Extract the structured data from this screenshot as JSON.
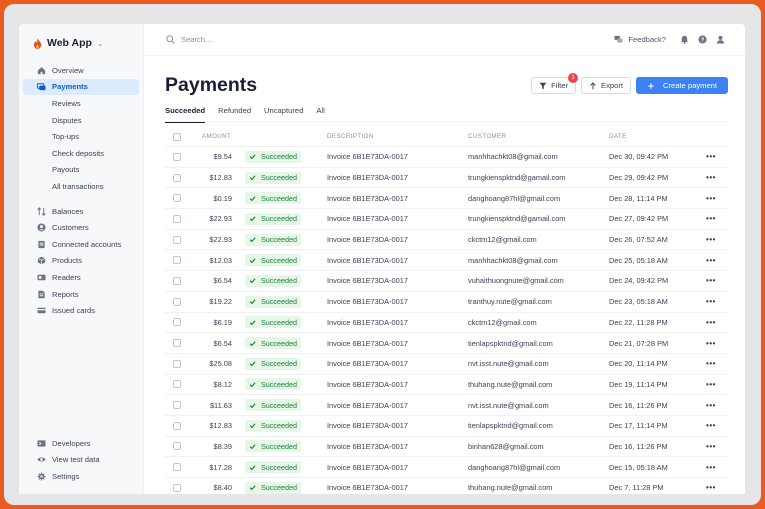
{
  "app": {
    "name": "Web App"
  },
  "sidebar": {
    "items": [
      {
        "label": "Overview",
        "icon": "home-icon",
        "active": false,
        "sub": false
      },
      {
        "label": "Payments",
        "icon": "payments-icon",
        "active": true,
        "sub": false
      },
      {
        "label": "Reviews",
        "icon": "",
        "active": false,
        "sub": true
      },
      {
        "label": "Disputes",
        "icon": "",
        "active": false,
        "sub": true
      },
      {
        "label": "Top-ups",
        "icon": "",
        "active": false,
        "sub": true
      },
      {
        "label": "Check deposits",
        "icon": "",
        "active": false,
        "sub": true
      },
      {
        "label": "Payouts",
        "icon": "",
        "active": false,
        "sub": true
      },
      {
        "label": "All transactions",
        "icon": "",
        "active": false,
        "sub": true
      }
    ],
    "items2": [
      {
        "label": "Balances",
        "icon": "balances-icon"
      },
      {
        "label": "Customers",
        "icon": "customers-icon"
      },
      {
        "label": "Connected accounts",
        "icon": "connected-accounts-icon"
      },
      {
        "label": "Products",
        "icon": "products-icon"
      },
      {
        "label": "Readers",
        "icon": "readers-icon"
      },
      {
        "label": "Reports",
        "icon": "reports-icon"
      },
      {
        "label": "Issued cards",
        "icon": "card-icon"
      }
    ],
    "bottom": [
      {
        "label": "Developers",
        "icon": "terminal-icon"
      },
      {
        "label": "View test data",
        "icon": "eye-icon"
      },
      {
        "label": "Settings",
        "icon": "gear-icon"
      }
    ]
  },
  "topbar": {
    "search_placeholder": "Search...",
    "feedback_label": "Feedback?"
  },
  "page": {
    "title": "Payments",
    "filter_label": "Filter",
    "filter_badge": "1",
    "export_label": "Export",
    "create_label": "Create payment",
    "tabs": [
      "Succeeded",
      "Refunded",
      "Uncaptured",
      "All"
    ]
  },
  "table": {
    "headers": {
      "amount": "AMOUNT",
      "description": "DESCRIPTION",
      "customer": "CUSTOMER",
      "date": "DATE"
    },
    "rows": [
      {
        "amount": "$9.54",
        "status": "Succeeded",
        "description": "Invoice 6B1E73DA-0017",
        "customer": "manhhachkt08@gmail.com",
        "date": "Dec 30, 09:42 PM"
      },
      {
        "amount": "$12.83",
        "status": "Succeeded",
        "description": "Invoice 6B1E73DA-0017",
        "customer": "trungkienspktnd@gamail.com",
        "date": "Dec 29, 09:42 PM"
      },
      {
        "amount": "$0.19",
        "status": "Succeeded",
        "description": "Invoice 6B1E73DA-0017",
        "customer": "danghoang87hl@gmail.com",
        "date": "Dec 28, 11:14 PM"
      },
      {
        "amount": "$22.93",
        "status": "Succeeded",
        "description": "Invoice 6B1E73DA-0017",
        "customer": "trungkienspktnd@gamail.com",
        "date": "Dec 27, 09:42 PM"
      },
      {
        "amount": "$22.93",
        "status": "Succeeded",
        "description": "Invoice 6B1E73DA-0017",
        "customer": "ckctm12@gmail.com",
        "date": "Dec 26, 07:52 AM"
      },
      {
        "amount": "$12.03",
        "status": "Succeeded",
        "description": "Invoice 6B1E73DA-0017",
        "customer": "manhhachkt08@gmail.com",
        "date": "Dec 25, 05:18 AM"
      },
      {
        "amount": "$6.54",
        "status": "Succeeded",
        "description": "Invoice 6B1E73DA-0017",
        "customer": "vuhaithuongnute@gmail.com",
        "date": "Dec 24, 09:42 PM"
      },
      {
        "amount": "$19.22",
        "status": "Succeeded",
        "description": "Invoice 6B1E73DA-0017",
        "customer": "tranthuy.nute@gmail.com",
        "date": "Dec 23, 05:18 AM"
      },
      {
        "amount": "$6.19",
        "status": "Succeeded",
        "description": "Invoice 6B1E73DA-0017",
        "customer": "ckctm12@gmail.com",
        "date": "Dec 22, 11:28 PM"
      },
      {
        "amount": "$6.54",
        "status": "Succeeded",
        "description": "Invoice 6B1E73DA-0017",
        "customer": "tienlapspktnd@gmail.com",
        "date": "Dec 21, 07:28 PM"
      },
      {
        "amount": "$25.08",
        "status": "Succeeded",
        "description": "Invoice 6B1E73DA-0017",
        "customer": "nvt.isst.nute@gmail.com",
        "date": "Dec 20, 11:14 PM"
      },
      {
        "amount": "$8.12",
        "status": "Succeeded",
        "description": "Invoice 6B1E73DA-0017",
        "customer": "thuhang.nute@gmail.com",
        "date": "Dec 19, 11:14 PM"
      },
      {
        "amount": "$11.63",
        "status": "Succeeded",
        "description": "Invoice 6B1E73DA-0017",
        "customer": "nvt.isst.nute@gmail.com",
        "date": "Dec 16, 11:26 PM"
      },
      {
        "amount": "$12.83",
        "status": "Succeeded",
        "description": "Invoice 6B1E73DA-0017",
        "customer": "tienlapspktnd@gmail.com",
        "date": "Dec 17, 11:14 PM"
      },
      {
        "amount": "$8.39",
        "status": "Succeeded",
        "description": "Invoice 6B1E73DA-0017",
        "customer": "binhan628@gmail.com",
        "date": "Dec 16, 11:26 PM"
      },
      {
        "amount": "$17.28",
        "status": "Succeeded",
        "description": "Invoice 6B1E73DA-0017",
        "customer": "danghoang87hl@gmail.com",
        "date": "Dec 15, 05:18 AM"
      },
      {
        "amount": "$8.40",
        "status": "Succeeded",
        "description": "Invoice 6B1E73DA-0017",
        "customer": "thuhang.nute@gmail.com",
        "date": "Dec 7, 11:28 PM"
      }
    ]
  }
}
